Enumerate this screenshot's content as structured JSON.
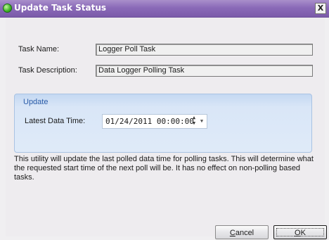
{
  "window": {
    "title": "Update Task Status",
    "close_label": "X"
  },
  "fields": {
    "task_name_label": "Task Name:",
    "task_name_value": "Logger Poll Task",
    "task_description_label": "Task Description:",
    "task_description_value": "Data Logger Polling Task"
  },
  "update_group": {
    "title": "Update",
    "latest_data_time_label": "Latest Data Time:",
    "latest_data_time_value": "01/24/2011  00:00:00"
  },
  "description": "This utility will update the last polled data time for polling tasks.  This will determine what the requested start time of the next poll will be.  It has no effect on non-polling based tasks.",
  "buttons": {
    "cancel_first": "C",
    "cancel_rest": "ancel",
    "ok_first": "O",
    "ok_rest": "K"
  },
  "colors": {
    "titlebar": "#8a6ab8",
    "group_background": "#d9e6f7",
    "group_title": "#2a5ca8"
  }
}
